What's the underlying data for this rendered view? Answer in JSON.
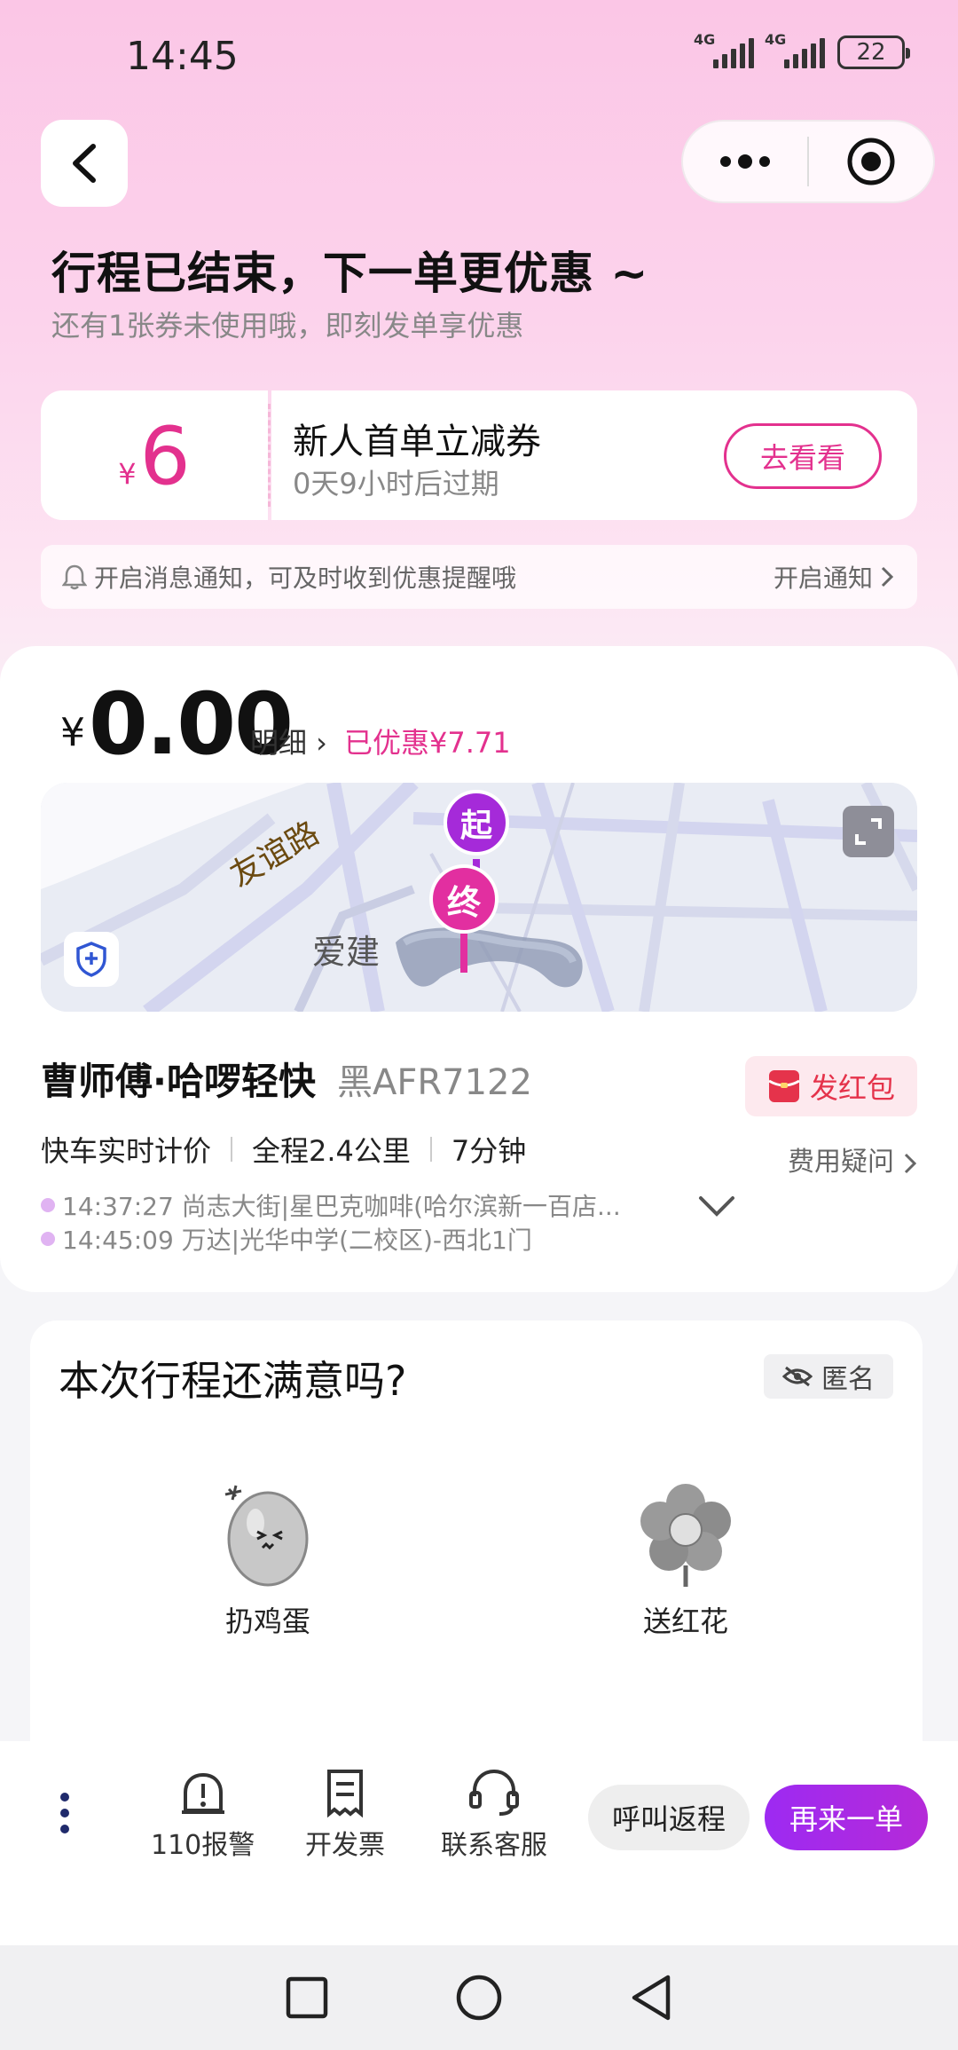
{
  "status_bar": {
    "time": "14:45",
    "net1": "4G",
    "net2": "4G",
    "battery": "22"
  },
  "header": {
    "title": "行程已结束，下一单更优惠 ~",
    "subtitle": "还有1张券未使用哦，即刻发单享优惠"
  },
  "coupon": {
    "currency": "¥",
    "amount": "6",
    "title": "新人首单立减券",
    "expiry": "0天9小时后过期",
    "button": "去看看"
  },
  "notify": {
    "text": "开启消息通知，可及时收到优惠提醒哦",
    "action": "开启通知"
  },
  "fare": {
    "currency": "¥",
    "amount": "0.00",
    "detail_link": "明细 ›",
    "discount": "已优惠¥7.71"
  },
  "map": {
    "road_label": "友谊路",
    "area_label": "爱建",
    "start_marker": "起",
    "end_marker": "终"
  },
  "driver": {
    "name": "曹师傅·哈啰轻快",
    "plate": "黑AFR7122",
    "red_packet": "发红包"
  },
  "trip": {
    "pricing": "快车实时计价",
    "distance": "全程2.4公里",
    "duration": "7分钟",
    "fee_question": "费用疑问"
  },
  "route": {
    "start": "14:37:27 尚志大街|星巴克咖啡(哈尔滨新一百店...",
    "end": "14:45:09 万达|光华中学(二校区)-西北1门"
  },
  "rating": {
    "title": "本次行程还满意吗?",
    "anonymous": "匿名",
    "options": [
      "扔鸡蛋",
      "送红花"
    ]
  },
  "bottom_bar": {
    "tools": [
      "110报警",
      "开发票",
      "联系客服"
    ],
    "call_back": "呼叫返程",
    "order_again": "再来一单"
  },
  "colors": {
    "accent": "#e3318e",
    "primary_button": "#a02bf0",
    "red_packet": "#e5334b"
  }
}
